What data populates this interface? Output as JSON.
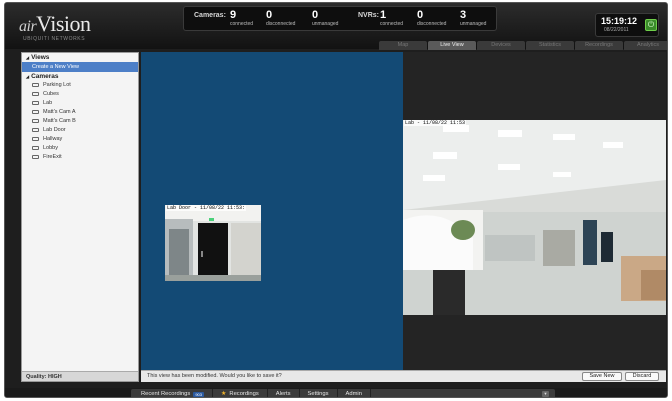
{
  "app": {
    "brand_prefix": "air",
    "brand_name": "Vision",
    "brand_sub": "UBIQUITI NETWORKS"
  },
  "stats": {
    "cameras_label": "Cameras:",
    "nvrs_label": "NVRs:",
    "cameras": [
      {
        "value": "9",
        "caption": "connected"
      },
      {
        "value": "0",
        "caption": "disconnected"
      },
      {
        "value": "0",
        "caption": "unmanaged"
      }
    ],
    "nvrs": [
      {
        "value": "1",
        "caption": "connected"
      },
      {
        "value": "0",
        "caption": "disconnected"
      },
      {
        "value": "3",
        "caption": "unmanaged"
      }
    ]
  },
  "clock": {
    "time": "15:19:12",
    "date": "08/22/2011"
  },
  "tabs": [
    "Map",
    "Live View",
    "Devices",
    "Statistics",
    "Recordings",
    "Analytics"
  ],
  "active_tab": "Live View",
  "sidebar": {
    "views_header": "Views",
    "create_view": "Create a New View",
    "cameras_header": "Cameras",
    "cameras": [
      "Parking Lot",
      "Cubes",
      "Lab",
      "Matt's Cam A",
      "Matt's Cam B",
      "Lab Door",
      "Hallway",
      "Lobby",
      "FireExit"
    ],
    "quality": "Quality: HIGH"
  },
  "feeds": {
    "small_label": "Lab Door - 11/08/22 11:53:",
    "large_label": "Lab - 11/08/22 11:53"
  },
  "status": {
    "message": "This view has been modified. Would you like to save it?",
    "save_new": "Save New",
    "discard": "Discard"
  },
  "bottombar": {
    "recent_recordings": "Recent Recordings",
    "recent_badge": "903",
    "recordings": "Recordings",
    "alerts": "Alerts",
    "settings": "Settings",
    "admin": "Admin"
  },
  "colors": {
    "accent": "#4d7fc7",
    "pane_blue": "#134a75",
    "power_green": "#3a8b2a"
  }
}
